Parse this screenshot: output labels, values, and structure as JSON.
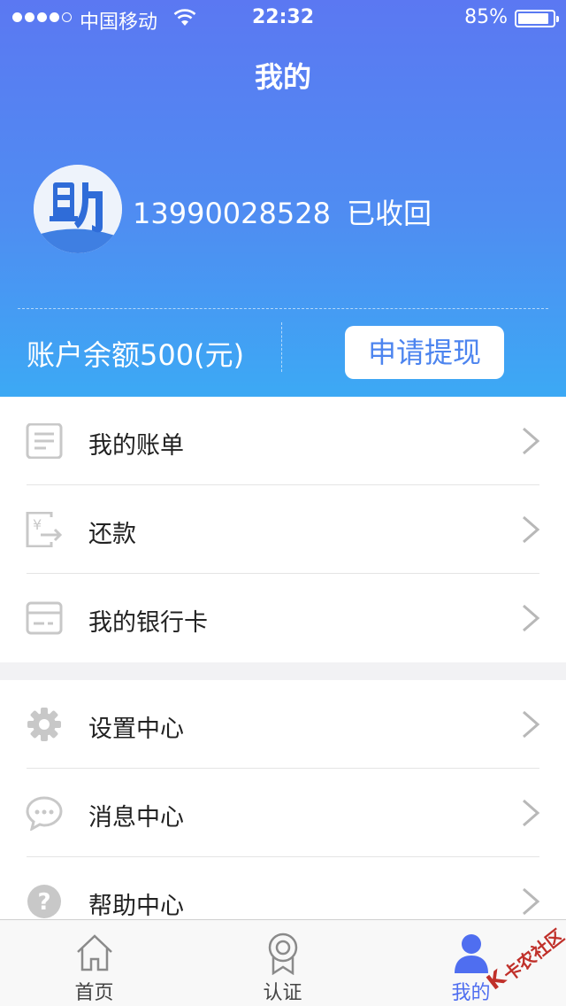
{
  "status_bar": {
    "carrier": "中国移动",
    "time": "22:32",
    "battery_percent": "85%",
    "battery_level": 0.85,
    "signal_bars": 4,
    "signal_total": 5
  },
  "nav": {
    "title": "我的"
  },
  "profile": {
    "phone": "13990028528",
    "status": "已收回",
    "avatar_icon": "zhu-logo-icon"
  },
  "account": {
    "balance_label": "账户余额500(元)",
    "withdraw_label": "申请提现"
  },
  "menu_group_1": [
    {
      "label": "我的账单",
      "icon": "bill-icon"
    },
    {
      "label": "还款",
      "icon": "repayment-icon"
    },
    {
      "label": "我的银行卡",
      "icon": "bank-card-icon"
    }
  ],
  "menu_group_2": [
    {
      "label": "设置中心",
      "icon": "gear-icon"
    },
    {
      "label": "消息中心",
      "icon": "message-icon"
    },
    {
      "label": "帮助中心",
      "icon": "help-icon"
    }
  ],
  "tabs": [
    {
      "label": "首页",
      "icon": "home-icon"
    },
    {
      "label": "认证",
      "icon": "certification-icon"
    },
    {
      "label": "我的",
      "icon": "user-icon",
      "active": true
    }
  ],
  "watermark": {
    "text": "卡农社区"
  },
  "colors": {
    "header_top": "#5b78f2",
    "header_bottom": "#3ca9f4",
    "accent": "#4f6ef0",
    "button_text": "#4c84ef"
  }
}
